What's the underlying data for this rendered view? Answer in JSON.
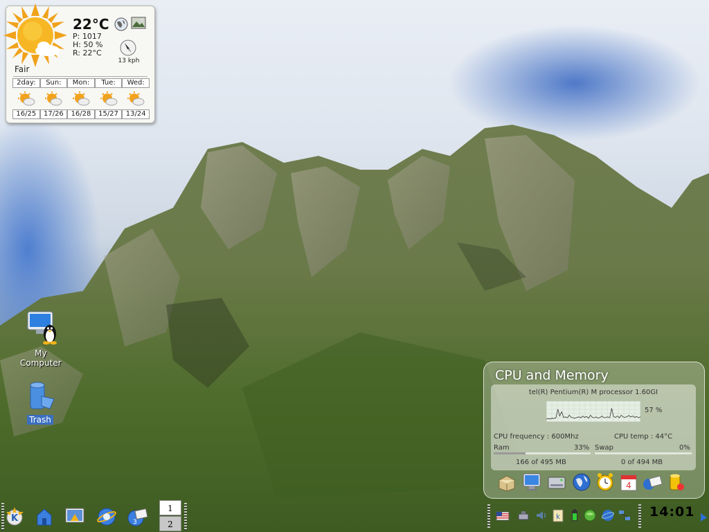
{
  "weather": {
    "temperature": "22°C",
    "pressure": "P: 1017",
    "humidity": "H: 50 %",
    "realfeel": "R: 22°C",
    "wind_speed": "13 kph",
    "condition": "Fair",
    "forecast": [
      {
        "day": "2day:",
        "range": "16/25"
      },
      {
        "day": "Sun:",
        "range": "17/26"
      },
      {
        "day": "Mon:",
        "range": "16/28"
      },
      {
        "day": "Tue:",
        "range": "15/27"
      },
      {
        "day": "Wed:",
        "range": "13/24"
      }
    ]
  },
  "desktop_icons": {
    "my_computer": "My Computer",
    "trash": "Trash"
  },
  "cpu_widget": {
    "title": "CPU and Memory",
    "processor": "tel(R) Pentium(R) M processor 1.60GI",
    "cpu_load": "57 %",
    "cpu_frequency": "CPU frequency : 600Mhz",
    "cpu_temp": "CPU temp : 44°C",
    "ram_label": "Ram",
    "ram_pct": "33%",
    "ram_fraction": 0.33,
    "ram_usage": "166 of 495 MB",
    "swap_label": "Swap",
    "swap_pct": "0%",
    "swap_fraction": 0.0,
    "swap_usage": "0 of 494 MB",
    "cpu_history": [
      5,
      6,
      5,
      7,
      6,
      8,
      28,
      12,
      22,
      9,
      10,
      8,
      14,
      9,
      8,
      7,
      9,
      10,
      8,
      12,
      9,
      11,
      7,
      14,
      9,
      8,
      10,
      7,
      9,
      12,
      8,
      9,
      10,
      8,
      30,
      11,
      9,
      12,
      8,
      14,
      10,
      9,
      11,
      13,
      10,
      12,
      9,
      11,
      8,
      10
    ],
    "launcher_icons": [
      "package-icon",
      "monitor-icon",
      "drive-icon",
      "globe-icon",
      "alarm-clock-icon",
      "calendar-icon",
      "mail-icon",
      "trash-can-icon"
    ]
  },
  "taskbar": {
    "pager": [
      "1",
      "2"
    ],
    "clock": "14:01",
    "launcher_icons": [
      "kde-menu-icon",
      "home-folder-icon",
      "desktop-icon",
      "browser-icon",
      "kontact-icon"
    ],
    "tray_icons": [
      "keyboard-flag-icon",
      "network-icon",
      "volume-icon",
      "klipper-icon",
      "battery-icon",
      "kopete-icon",
      "globe-status-icon",
      "network-manager-icon"
    ]
  },
  "colors": {
    "trash_label_bg": "#3b6fc0"
  }
}
